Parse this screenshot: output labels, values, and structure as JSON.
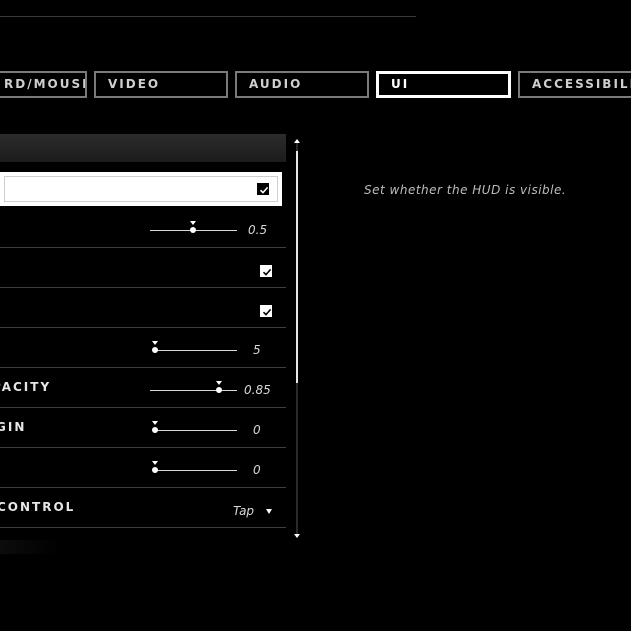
{
  "tabs": [
    {
      "label": "RD/MOUSE",
      "active": false
    },
    {
      "label": "VIDEO",
      "active": false
    },
    {
      "label": "AUDIO",
      "active": false
    },
    {
      "label": "UI",
      "active": true
    },
    {
      "label": "ACCESSIBILIT",
      "active": false
    }
  ],
  "settings": {
    "rows": [
      {
        "label": "",
        "type": "checkbox",
        "checked": true,
        "selected": true
      },
      {
        "label": "",
        "type": "slider",
        "value": "0.5",
        "level": 0.5
      },
      {
        "label": "",
        "type": "checkbox",
        "checked": true
      },
      {
        "label": "",
        "type": "checkbox",
        "checked": true
      },
      {
        "label": "",
        "type": "slider",
        "value": "5",
        "level": 0.0
      },
      {
        "label": "PACITY",
        "type": "slider",
        "value": "0.85",
        "level": 0.85
      },
      {
        "label": "GIN",
        "type": "slider",
        "value": "0",
        "level": 0.0
      },
      {
        "label": "",
        "type": "slider",
        "value": "0",
        "level": 0.0
      },
      {
        "label": "CONTROL",
        "type": "dropdown",
        "value": "Tap"
      }
    ]
  },
  "description": "Set whether the HUD is visible.",
  "icons": {
    "check": "checkmark-icon",
    "dropdown": "caret-down-icon",
    "scroll_up": "scroll-up-arrow-icon",
    "scroll_down": "scroll-down-arrow-icon"
  },
  "colors": {
    "background": "#000000",
    "active_border": "#ffffff",
    "inactive_border": "#7a7a7a",
    "selected_row": "#ffffff"
  }
}
